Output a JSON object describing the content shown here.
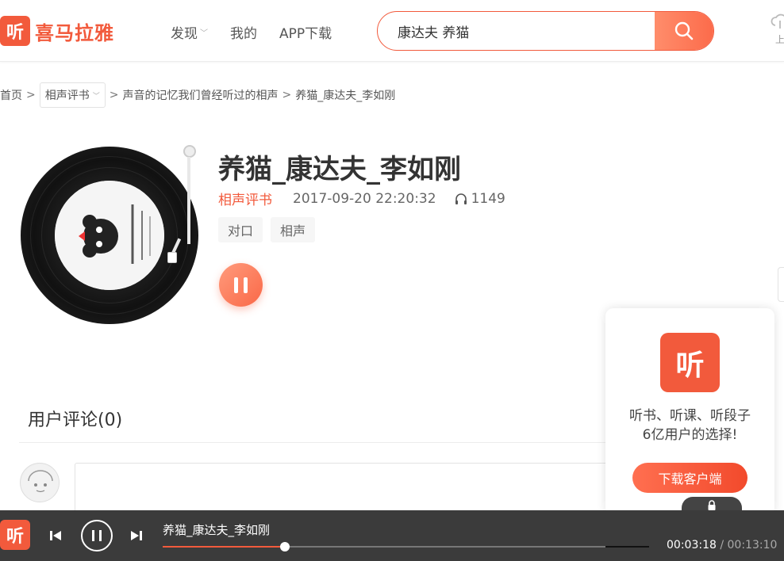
{
  "header": {
    "logo_glyph": "听",
    "logo_text": "喜马拉雅",
    "nav": [
      {
        "label": "发现",
        "has_dropdown": true
      },
      {
        "label": "我的",
        "has_dropdown": false
      },
      {
        "label": "APP下载",
        "has_dropdown": false
      }
    ],
    "search_value": "康达夫 养猫",
    "upload_label": "上"
  },
  "breadcrumb": {
    "home": "首页",
    "category": "相声评书",
    "album": "声音的记忆我们曾经听过的相声",
    "current": "养猫_康达夫_李如刚"
  },
  "track": {
    "title": "养猫_康达夫_李如刚",
    "category": "相声评书",
    "date": "2017-09-20 22:20:32",
    "plays": "1149",
    "tags": [
      "对口",
      "相声"
    ]
  },
  "comments": {
    "title": "用户评论(0)"
  },
  "download_card": {
    "logo_glyph": "听",
    "line1": "听书、听课、听段子",
    "line2": "6亿用户的选择!",
    "button": "下载客户端"
  },
  "player": {
    "logo_glyph": "听",
    "title": "养猫_康达夫_李如刚",
    "current_time": "00:03:18",
    "separator": "/",
    "total_time": "00:13:10",
    "progress": 0.251
  },
  "colors": {
    "accent": "#f25a3c",
    "player_bg": "#3b3b3b"
  }
}
